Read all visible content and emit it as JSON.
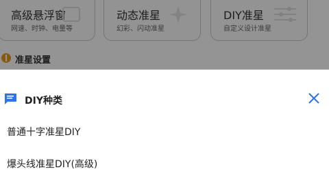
{
  "cards": [
    {
      "title": "高级悬浮窗",
      "subtitle": "网速、时钟、电量等"
    },
    {
      "title": "动态准星",
      "subtitle": "幻彩、闪动准星"
    },
    {
      "title": "DIY准星",
      "subtitle": "自定义设计准星"
    }
  ],
  "section": {
    "label": "准星设置"
  },
  "sheet": {
    "title": "DIY种类",
    "options": [
      "普通十字准星DIY",
      "爆头线准星DIY(高级)"
    ]
  },
  "colors": {
    "accent": "#2f73e8",
    "section_dot": "#e89a1e",
    "scrim": "rgba(0,0,0,0.42)"
  },
  "icons": {
    "sheet_icon": "chat-bubble-icon",
    "close": "close-icon"
  }
}
